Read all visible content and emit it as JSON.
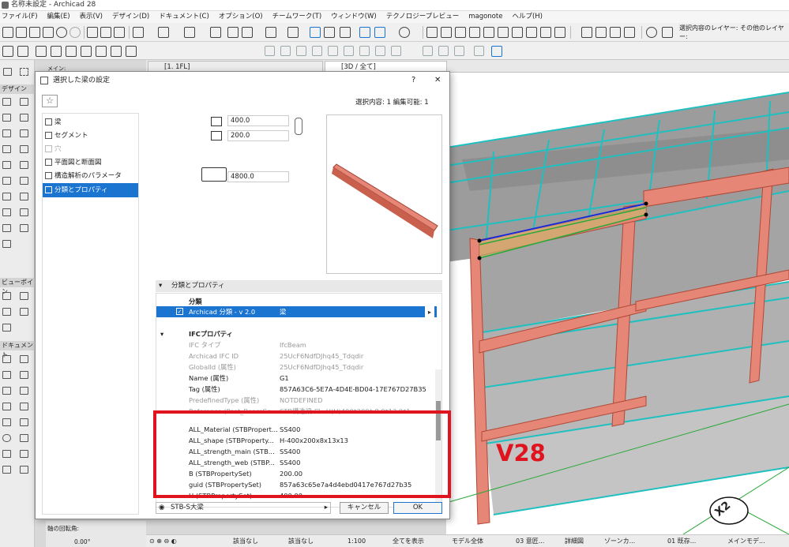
{
  "window": {
    "title": "名称未設定 - Archicad 28"
  },
  "menu": [
    "ファイル(F)",
    "編集(E)",
    "表示(V)",
    "デザイン(D)",
    "ドキュメント(C)",
    "オプション(O)",
    "チームワーク(T)",
    "ウィンドウ(W)",
    "テクノロジープレビュー",
    "magonote",
    "ヘルプ(H)"
  ],
  "layer": {
    "line1": "選択内容のレイヤー:",
    "line2": "その他のレイヤー:"
  },
  "tabs": [
    {
      "label": "[1. 1FL]"
    },
    {
      "label": "[3D / 全て]"
    }
  ],
  "left_panel": {
    "main": "メイン:",
    "design": "デザイン",
    "viewpoint": "ビューポイン",
    "document": "ドキュメント",
    "rotation": "軸の回転角:",
    "angle": "0.00°"
  },
  "dialog": {
    "title": "選択した梁の設定",
    "help": "?",
    "close": "✕",
    "selection": "選択内容: 1 編集可能: 1",
    "nav": [
      "梁",
      "セグメント",
      "穴",
      "平面図と断面図",
      "構造解析のパラメータ",
      "分類とプロパティ"
    ],
    "params": {
      "height": "400.0",
      "width": "200.0",
      "length": "4800.0"
    },
    "section_title": "分類とプロパティ",
    "classification_header": "分類",
    "classification_row": {
      "name": "Archicad 分類 - v 2.0",
      "value": "梁"
    },
    "ifc_title": "IFCプロパティ",
    "ifc_rows": [
      {
        "k": "IFC タイプ",
        "v": "IfcBeam",
        "dim": true
      },
      {
        "k": "Archicad IFC ID",
        "v": "25UcF6NdfDJhq45_Tdqdir",
        "dim": true
      },
      {
        "k": "GlobalId (属性)",
        "v": "25UcF6NdfDJhq45_Tdqdir",
        "dim": true
      },
      {
        "k": "Name (属性)",
        "v": "G1",
        "dim": false
      },
      {
        "k": "Tag (属性)",
        "v": "857A63C6-5E7A-4D4E-BD04-17E767D27B35",
        "dim": false
      },
      {
        "k": "PredefinedType (属性)",
        "v": "NOTDEFINED",
        "dim": true
      },
      {
        "k": "Reference (Pset_BeamCo...",
        "v": "STB構造梁 ロ=H(H)400*200*.8.0*13.0*1",
        "dim": true
      }
    ],
    "stb_rows": [
      {
        "k": "ALL_Material (STBPropert...",
        "v": "SS400"
      },
      {
        "k": "ALL_shape (STBProperty...",
        "v": "H-400x200x8x13x13"
      },
      {
        "k": "ALL_strength_main (STB...",
        "v": "SS400"
      },
      {
        "k": "ALL_strength_web (STBP...",
        "v": "SS400"
      },
      {
        "k": "B (STBPropertySet)",
        "v": "200.00"
      },
      {
        "k": "guid (STBPropertySet)",
        "v": "857a63c65e7a4d4ebd0417e767d27b35"
      },
      {
        "k": "H (STBPropertySet)",
        "v": "400.00"
      }
    ],
    "favorite": "STB-S大梁",
    "cancel": "キャンセル",
    "ok": "OK"
  },
  "annotation": {
    "label": "V28",
    "grid": "X2"
  },
  "status": {
    "s1": "該当なし",
    "s2": "該当なし",
    "scale": "1:100",
    "showall": "全てを表示",
    "model": "モデル全体",
    "s3": "03 意匠...",
    "detail": "詳細図",
    "zone": "ゾーンカ...",
    "s4": "01 既存...",
    "menu": "メインモデ..."
  }
}
